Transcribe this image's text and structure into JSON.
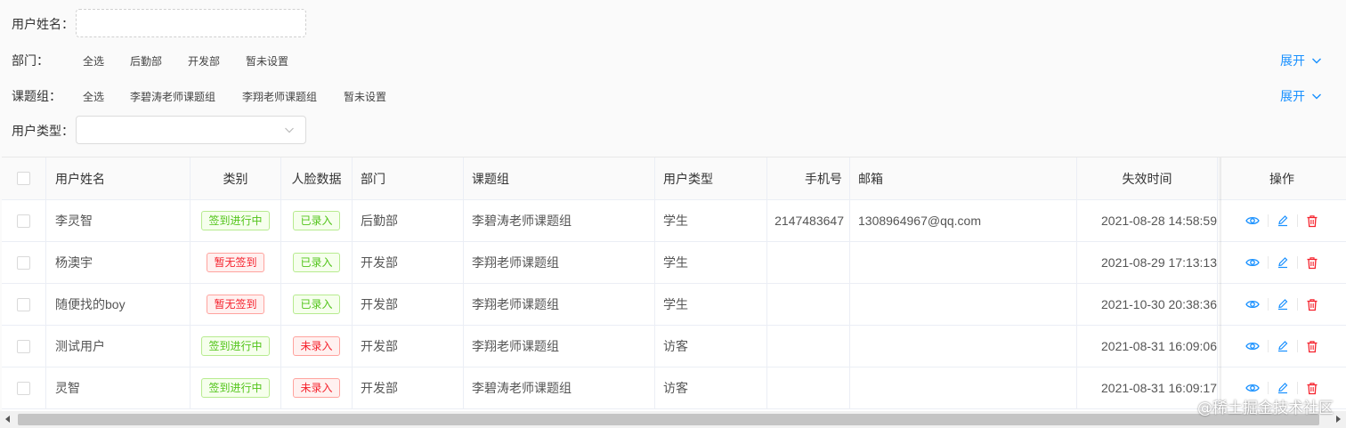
{
  "filters": {
    "name_label": "用户姓名：",
    "name_value": "",
    "dept_label": "部门：",
    "dept_options": [
      "全选",
      "后勤部",
      "开发部",
      "暂未设置"
    ],
    "dept_expand": "展开",
    "group_label": "课题组：",
    "group_options": [
      "全选",
      "李碧涛老师课题组",
      "李翔老师课题组",
      "暂未设置"
    ],
    "group_expand": "展开",
    "type_label": "用户类型：",
    "type_value": ""
  },
  "table": {
    "columns": [
      "用户姓名",
      "类别",
      "人脸数据",
      "部门",
      "课题组",
      "用户类型",
      "手机号",
      "邮箱",
      "失效时间",
      "操作"
    ],
    "rows": [
      {
        "name": "李灵智",
        "category": "签到进行中",
        "category_status": "green",
        "face": "已录入",
        "face_status": "green",
        "dept": "后勤部",
        "group": "李碧涛老师课题组",
        "user_type": "学生",
        "phone": "2147483647",
        "email": "1308964967@qq.com",
        "expire": "2021-08-28 14:58:59"
      },
      {
        "name": "杨澳宇",
        "category": "暂无签到",
        "category_status": "red",
        "face": "已录入",
        "face_status": "green",
        "dept": "开发部",
        "group": "李翔老师课题组",
        "user_type": "学生",
        "phone": "",
        "email": "",
        "expire": "2021-08-29 17:13:13"
      },
      {
        "name": "随便找的boy",
        "category": "暂无签到",
        "category_status": "red",
        "face": "已录入",
        "face_status": "green",
        "dept": "开发部",
        "group": "李翔老师课题组",
        "user_type": "学生",
        "phone": "",
        "email": "",
        "expire": "2021-10-30 20:38:36"
      },
      {
        "name": "测试用户",
        "category": "签到进行中",
        "category_status": "green",
        "face": "未录入",
        "face_status": "red",
        "dept": "开发部",
        "group": "李翔老师课题组",
        "user_type": "访客",
        "phone": "",
        "email": "",
        "expire": "2021-08-31 16:09:06"
      },
      {
        "name": "灵智",
        "category": "签到进行中",
        "category_status": "green",
        "face": "未录入",
        "face_status": "red",
        "dept": "开发部",
        "group": "李碧涛老师课题组",
        "user_type": "访客",
        "phone": "",
        "email": "",
        "expire": "2021-08-31 16:09:17"
      }
    ],
    "row_actions": [
      "eye-icon",
      "edit-icon",
      "delete-icon"
    ]
  },
  "colors": {
    "accent": "#1890ff",
    "delete": "#f5222d",
    "tag_green": "#52c41a",
    "tag_red": "#f5222d"
  },
  "watermark": "@稀土掘金技术社区"
}
